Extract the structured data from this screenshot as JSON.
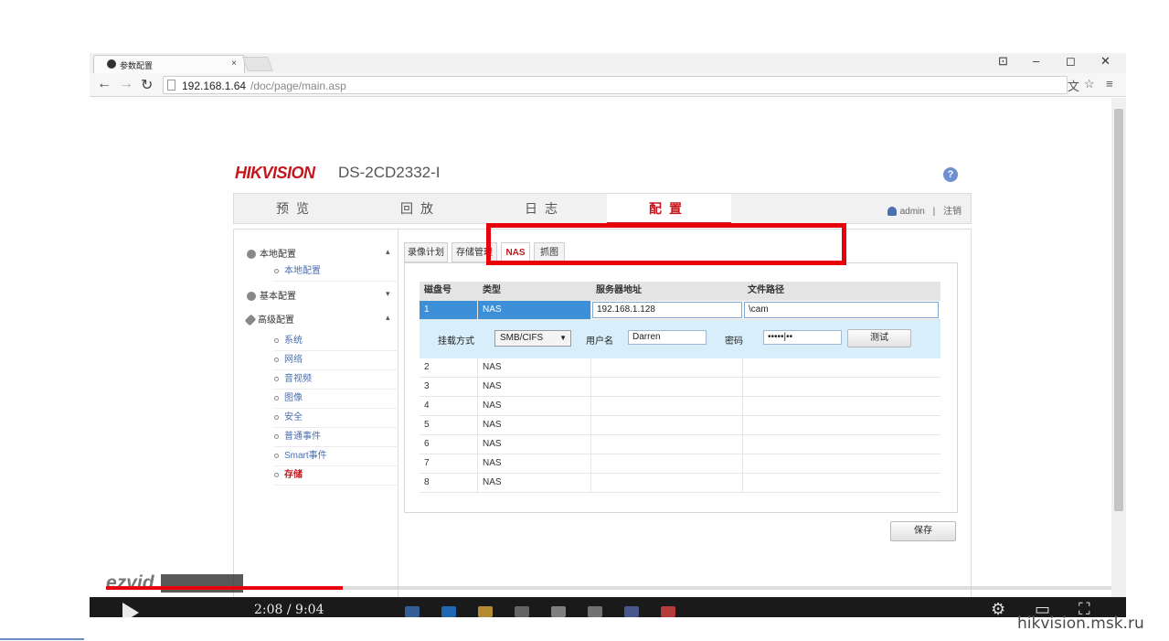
{
  "browser": {
    "tab_title": "参数配置",
    "tab_close": "×",
    "window_controls": [
      "⊡",
      "–",
      "◻",
      "✕"
    ],
    "url_host": "192.168.1.64",
    "url_path": "/doc/page/main.asp"
  },
  "header": {
    "brand": "HIKVISION",
    "model": "DS-2CD2332-I",
    "help": "?"
  },
  "main_nav": {
    "items": [
      "预览",
      "回放",
      "日志",
      "配置"
    ],
    "active": "配置",
    "user": "admin",
    "separator": "|",
    "logout": "注销"
  },
  "sidebar": {
    "groups": [
      {
        "label": "本地配置",
        "arrow": "▴",
        "items": [
          "本地配置"
        ]
      },
      {
        "label": "基本配置",
        "arrow": "▾",
        "items": []
      },
      {
        "label": "高级配置",
        "arrow": "▴",
        "items": [
          "系统",
          "网络",
          "音视频",
          "图像",
          "安全",
          "普通事件",
          "Smart事件",
          "存储"
        ]
      }
    ],
    "current_item": "存储"
  },
  "subtabs": [
    "录像计划",
    "存储管理",
    "NAS",
    "抓图"
  ],
  "active_subtab": "NAS",
  "nas_table": {
    "headers": [
      "磁盘号",
      "类型",
      "服务器地址",
      "文件路径"
    ],
    "selected_row": {
      "id": "1",
      "type": "NAS",
      "server": "192.168.1.128",
      "path": "\\cam"
    },
    "detail": {
      "mount_label": "挂载方式",
      "mount_value": "SMB/CIFS",
      "username_label": "用户名",
      "username_value": "Darren",
      "password_label": "密码",
      "password_value": "•••••|••",
      "test_button": "测试"
    },
    "rows": [
      {
        "id": "2",
        "type": "NAS"
      },
      {
        "id": "3",
        "type": "NAS"
      },
      {
        "id": "4",
        "type": "NAS"
      },
      {
        "id": "5",
        "type": "NAS"
      },
      {
        "id": "6",
        "type": "NAS"
      },
      {
        "id": "7",
        "type": "NAS"
      },
      {
        "id": "8",
        "type": "NAS"
      }
    ]
  },
  "save_button": "保存",
  "overlay": {
    "ezvid": "ezvid",
    "time": "2:08 / 9:04",
    "progress_fraction": 0.2353,
    "watermark": "hikvision.msk.ru",
    "highlight_color": "#e8000b"
  }
}
